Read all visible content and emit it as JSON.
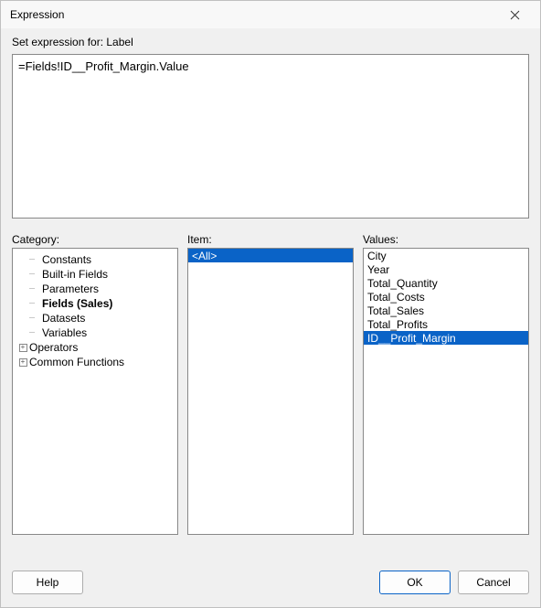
{
  "window": {
    "title": "Expression"
  },
  "setExpressionLabel": "Set expression for: Label",
  "expressionValue": "=Fields!ID__Profit_Margin.Value",
  "columns": {
    "category": {
      "label": "Category:"
    },
    "item": {
      "label": "Item:"
    },
    "values": {
      "label": "Values:"
    }
  },
  "categoryTree": [
    {
      "level": 1,
      "expander": null,
      "text": "Constants",
      "bold": false
    },
    {
      "level": 1,
      "expander": null,
      "text": "Built-in Fields",
      "bold": false
    },
    {
      "level": 1,
      "expander": null,
      "text": "Parameters",
      "bold": false
    },
    {
      "level": 1,
      "expander": null,
      "text": "Fields (Sales)",
      "bold": true
    },
    {
      "level": 1,
      "expander": null,
      "text": "Datasets",
      "bold": false
    },
    {
      "level": 1,
      "expander": null,
      "text": "Variables",
      "bold": false
    },
    {
      "level": 0,
      "expander": "plus",
      "text": "Operators",
      "bold": false
    },
    {
      "level": 0,
      "expander": "plus",
      "text": "Common Functions",
      "bold": false
    }
  ],
  "itemList": [
    {
      "text": "<All>",
      "selected": true
    }
  ],
  "valuesList": [
    {
      "text": "City",
      "selected": false
    },
    {
      "text": "Year",
      "selected": false
    },
    {
      "text": "Total_Quantity",
      "selected": false
    },
    {
      "text": "Total_Costs",
      "selected": false
    },
    {
      "text": "Total_Sales",
      "selected": false
    },
    {
      "text": "Total_Profits",
      "selected": false
    },
    {
      "text": "ID__Profit_Margin",
      "selected": true
    }
  ],
  "buttons": {
    "help": "Help",
    "ok": "OK",
    "cancel": "Cancel"
  }
}
